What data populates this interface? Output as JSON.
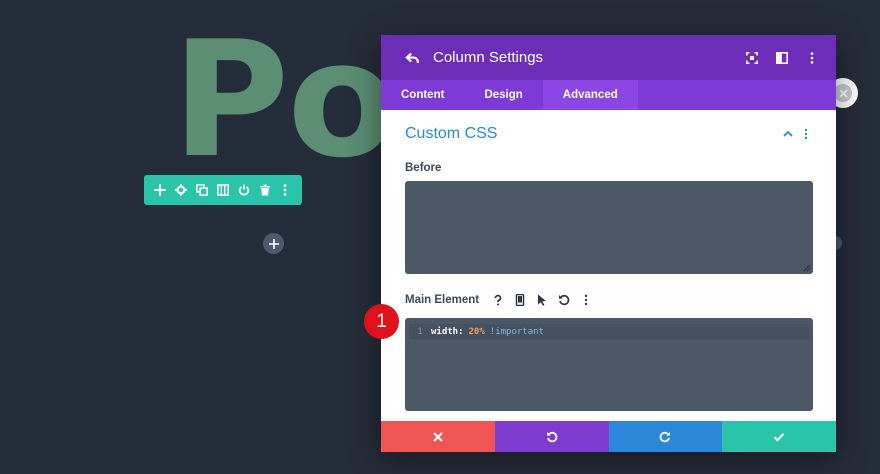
{
  "background": {
    "heading_text": "Por"
  },
  "colors": {
    "canvas": "#262d3a",
    "accent_teal": "#29c4a9",
    "header_purple": "#6c2eb9",
    "tabs_purple": "#7d3ad6",
    "section_blue": "#2b87da",
    "cancel_red": "#ef5555",
    "undo_purple": "#7e3bd0",
    "redo_blue": "#2b87da",
    "save_green": "#29c4a9"
  },
  "row_toolbar": {
    "icons": [
      "plus-icon",
      "gear-icon",
      "duplicate-icon",
      "columns-icon",
      "power-icon",
      "trash-icon",
      "more-vertical-icon"
    ]
  },
  "modal": {
    "title": "Column Settings",
    "tabs": [
      "Content",
      "Design",
      "Advanced"
    ],
    "active_tab": "Advanced",
    "section": {
      "title": "Custom CSS",
      "before_label": "Before",
      "main_element_label": "Main Element",
      "code": {
        "line_number": "1",
        "property": "width:",
        "value": "20%",
        "important": "!important"
      }
    }
  },
  "annotation": {
    "step": "1"
  }
}
